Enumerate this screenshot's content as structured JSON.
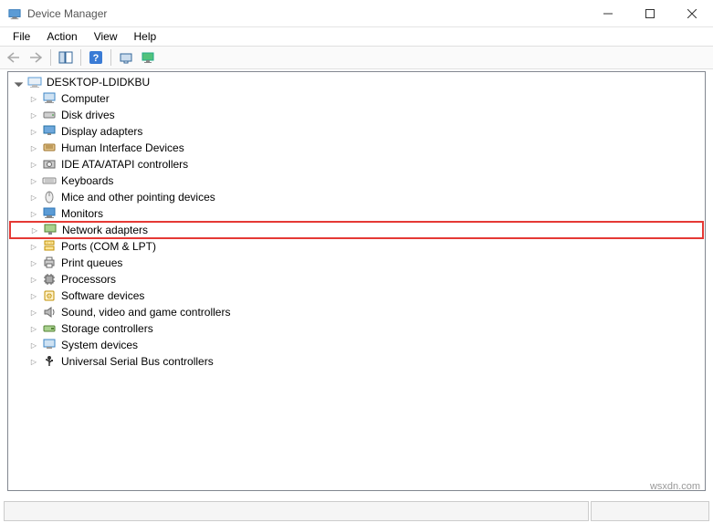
{
  "window": {
    "title": "Device Manager"
  },
  "menu": {
    "file": "File",
    "action": "Action",
    "view": "View",
    "help": "Help"
  },
  "tree": {
    "root": "DESKTOP-LDIDKBU",
    "items": [
      {
        "label": "Computer",
        "icon": "computer"
      },
      {
        "label": "Disk drives",
        "icon": "disk"
      },
      {
        "label": "Display adapters",
        "icon": "display"
      },
      {
        "label": "Human Interface Devices",
        "icon": "hid"
      },
      {
        "label": "IDE ATA/ATAPI controllers",
        "icon": "ide"
      },
      {
        "label": "Keyboards",
        "icon": "keyboard"
      },
      {
        "label": "Mice and other pointing devices",
        "icon": "mouse"
      },
      {
        "label": "Monitors",
        "icon": "monitor"
      },
      {
        "label": "Network adapters",
        "icon": "network",
        "highlighted": true
      },
      {
        "label": "Ports (COM & LPT)",
        "icon": "ports"
      },
      {
        "label": "Print queues",
        "icon": "printer"
      },
      {
        "label": "Processors",
        "icon": "cpu"
      },
      {
        "label": "Software devices",
        "icon": "software"
      },
      {
        "label": "Sound, video and game controllers",
        "icon": "sound"
      },
      {
        "label": "Storage controllers",
        "icon": "storage"
      },
      {
        "label": "System devices",
        "icon": "system"
      },
      {
        "label": "Universal Serial Bus controllers",
        "icon": "usb"
      }
    ]
  },
  "watermark": "wsxdn.com"
}
